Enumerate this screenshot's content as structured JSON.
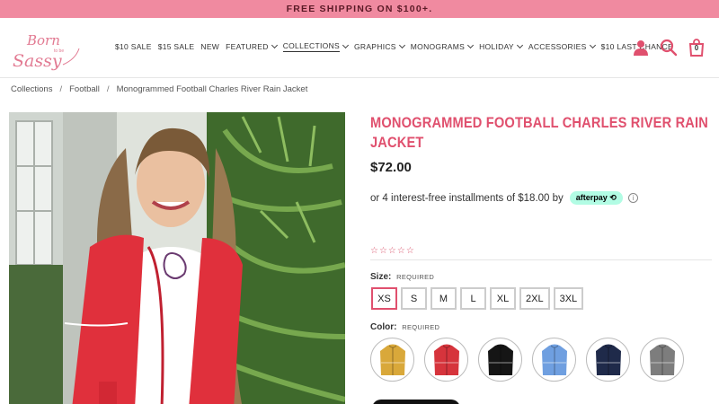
{
  "promo": {
    "text": "FREE SHIPPING ON $100+."
  },
  "header": {
    "logo_text_1": "Born",
    "logo_text_2": "to be",
    "logo_text_3": "Sassy",
    "nav": [
      {
        "label": "$10 SALE",
        "has_dropdown": false
      },
      {
        "label": "$15 SALE",
        "has_dropdown": false
      },
      {
        "label": "NEW",
        "has_dropdown": false
      },
      {
        "label": "FEATURED",
        "has_dropdown": true
      },
      {
        "label": "COLLECTIONS",
        "has_dropdown": true,
        "active": true
      },
      {
        "label": "GRAPHICS",
        "has_dropdown": true
      },
      {
        "label": "MONOGRAMS",
        "has_dropdown": true
      },
      {
        "label": "HOLIDAY",
        "has_dropdown": true
      },
      {
        "label": "ACCESSORIES",
        "has_dropdown": true
      },
      {
        "label": "$10 LAST CHANCE",
        "has_dropdown": false
      }
    ],
    "cart_count": "0",
    "icon_color": "#e0506e"
  },
  "breadcrumb": {
    "items": [
      "Collections",
      "Football",
      "Monogrammed Football Charles River Rain Jacket"
    ],
    "separator": "/"
  },
  "product": {
    "title": "Monogrammed Football Charles River Rain Jacket",
    "price": "$72.00",
    "installment_text": "or 4 interest-free installments of $18.00 by",
    "afterpay_label": "afterpay",
    "info_icon": "i",
    "stars": "☆☆☆☆☆",
    "size_label": "Size:",
    "size_required": "REQUIRED",
    "sizes": [
      "XS",
      "S",
      "M",
      "L",
      "XL",
      "2XL",
      "3XL"
    ],
    "selected_size": "XS",
    "color_label": "Color:",
    "color_required": "REQUIRED",
    "colors": [
      "#d9a83a",
      "#d6343c",
      "#151515",
      "#6f9fe0",
      "#1f2a4a",
      "#7d7d7d"
    ],
    "accent_color": "#e0506e"
  }
}
